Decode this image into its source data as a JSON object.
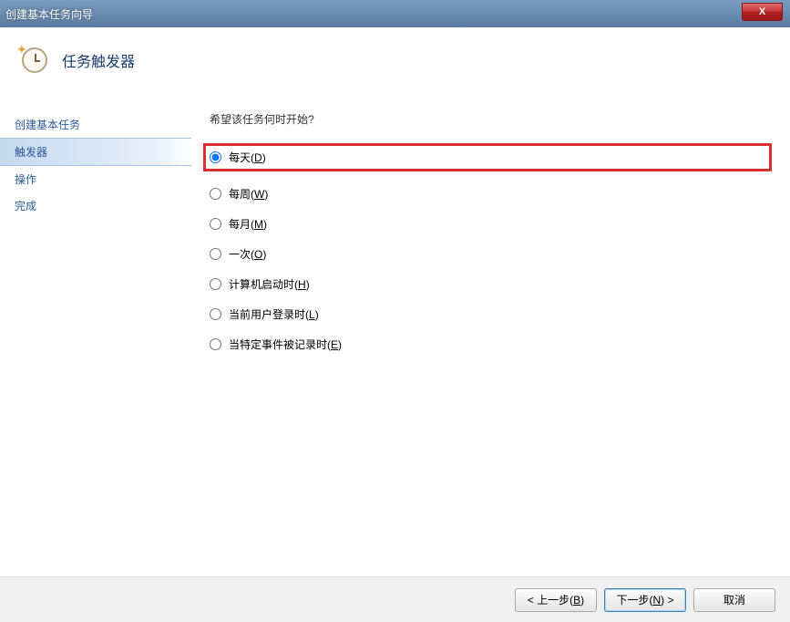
{
  "window": {
    "title": "创建基本任务向导",
    "close_label": "X"
  },
  "header": {
    "title": "任务触发器"
  },
  "sidebar": {
    "items": [
      {
        "label": "创建基本任务",
        "active": false
      },
      {
        "label": "触发器",
        "active": true
      },
      {
        "label": "操作",
        "active": false
      },
      {
        "label": "完成",
        "active": false
      }
    ]
  },
  "main": {
    "question": "希望该任务何时开始?",
    "options": [
      {
        "text": "每天",
        "hotkey": "D",
        "checked": true,
        "highlighted": true
      },
      {
        "text": "每周",
        "hotkey": "W",
        "checked": false,
        "highlighted": false
      },
      {
        "text": "每月",
        "hotkey": "M",
        "checked": false,
        "highlighted": false
      },
      {
        "text": "一次",
        "hotkey": "O",
        "checked": false,
        "highlighted": false
      },
      {
        "text": "计算机启动时",
        "hotkey": "H",
        "checked": false,
        "highlighted": false
      },
      {
        "text": "当前用户登录时",
        "hotkey": "L",
        "checked": false,
        "highlighted": false
      },
      {
        "text": "当特定事件被记录时",
        "hotkey": "E",
        "checked": false,
        "highlighted": false
      }
    ]
  },
  "buttons": {
    "back": {
      "prefix": "< 上一步",
      "hotkey": "B",
      "suffix": ""
    },
    "next": {
      "prefix": "下一步",
      "hotkey": "N",
      "suffix": " >"
    },
    "cancel": {
      "label": "取消"
    }
  }
}
